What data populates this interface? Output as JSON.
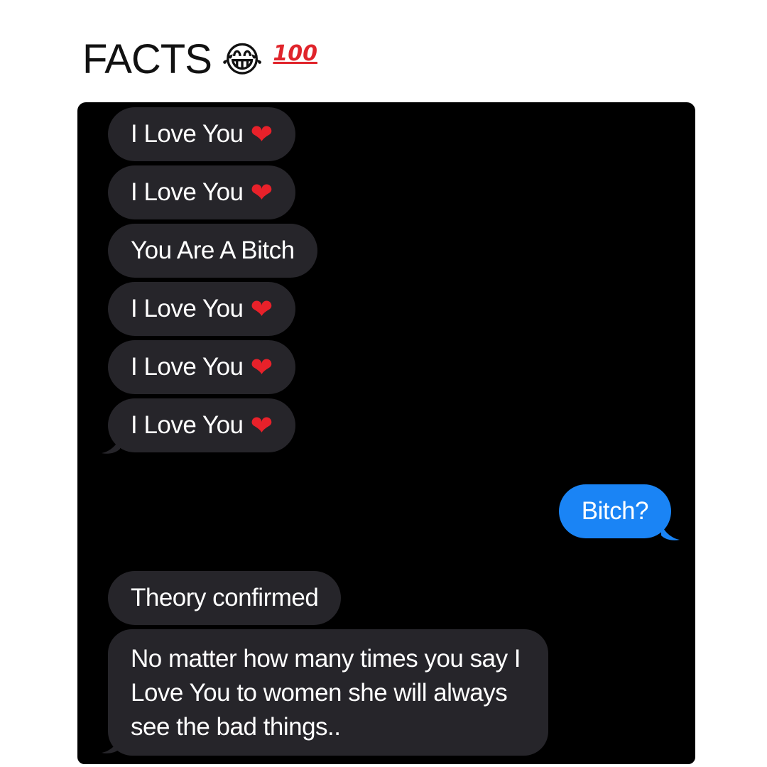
{
  "caption": {
    "text": "FACTS",
    "emoji_laugh": "😂",
    "emoji_100": "100"
  },
  "colors": {
    "chat_background": "#000000",
    "received_bubble": "#26252a",
    "sent_bubble": "#1a84f5",
    "heart": "#e8212a",
    "text": "#ffffff"
  },
  "messages": [
    {
      "direction": "received",
      "text": "I Love You",
      "emoji": "❤"
    },
    {
      "direction": "received",
      "text": "I Love You",
      "emoji": "❤"
    },
    {
      "direction": "received",
      "text": "You Are A Bitch",
      "emoji": ""
    },
    {
      "direction": "received",
      "text": "I Love You",
      "emoji": "❤"
    },
    {
      "direction": "received",
      "text": "I Love You",
      "emoji": "❤"
    },
    {
      "direction": "received",
      "text": "I Love You",
      "emoji": "❤"
    },
    {
      "direction": "sent",
      "text": "Bitch?",
      "emoji": ""
    },
    {
      "direction": "received",
      "text": "Theory confirmed",
      "emoji": ""
    },
    {
      "direction": "received",
      "text": "No matter how many times you say I Love You to women she will always see the bad things..",
      "emoji": ""
    }
  ]
}
